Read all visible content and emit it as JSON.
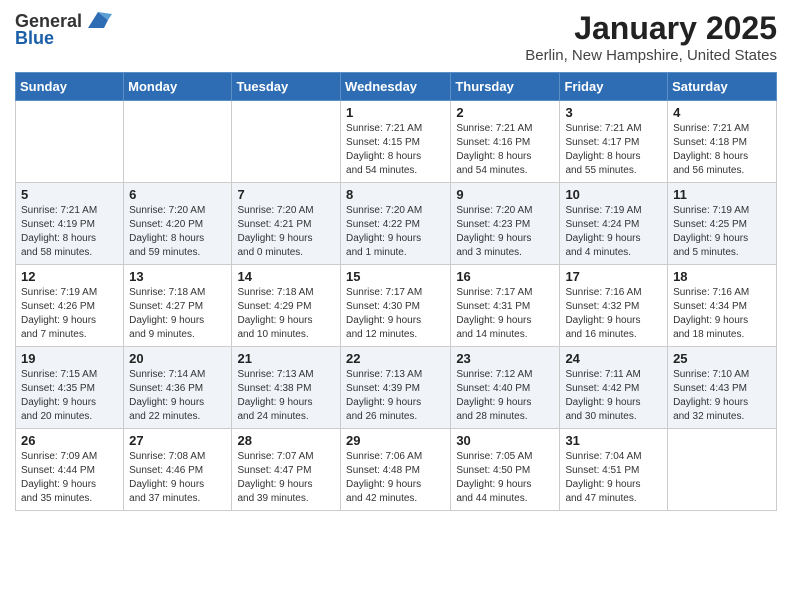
{
  "header": {
    "logo_general": "General",
    "logo_blue": "Blue",
    "month": "January 2025",
    "location": "Berlin, New Hampshire, United States"
  },
  "weekdays": [
    "Sunday",
    "Monday",
    "Tuesday",
    "Wednesday",
    "Thursday",
    "Friday",
    "Saturday"
  ],
  "weeks": [
    [
      {
        "day": "",
        "info": ""
      },
      {
        "day": "",
        "info": ""
      },
      {
        "day": "",
        "info": ""
      },
      {
        "day": "1",
        "info": "Sunrise: 7:21 AM\nSunset: 4:15 PM\nDaylight: 8 hours\nand 54 minutes."
      },
      {
        "day": "2",
        "info": "Sunrise: 7:21 AM\nSunset: 4:16 PM\nDaylight: 8 hours\nand 54 minutes."
      },
      {
        "day": "3",
        "info": "Sunrise: 7:21 AM\nSunset: 4:17 PM\nDaylight: 8 hours\nand 55 minutes."
      },
      {
        "day": "4",
        "info": "Sunrise: 7:21 AM\nSunset: 4:18 PM\nDaylight: 8 hours\nand 56 minutes."
      }
    ],
    [
      {
        "day": "5",
        "info": "Sunrise: 7:21 AM\nSunset: 4:19 PM\nDaylight: 8 hours\nand 58 minutes."
      },
      {
        "day": "6",
        "info": "Sunrise: 7:20 AM\nSunset: 4:20 PM\nDaylight: 8 hours\nand 59 minutes."
      },
      {
        "day": "7",
        "info": "Sunrise: 7:20 AM\nSunset: 4:21 PM\nDaylight: 9 hours\nand 0 minutes."
      },
      {
        "day": "8",
        "info": "Sunrise: 7:20 AM\nSunset: 4:22 PM\nDaylight: 9 hours\nand 1 minute."
      },
      {
        "day": "9",
        "info": "Sunrise: 7:20 AM\nSunset: 4:23 PM\nDaylight: 9 hours\nand 3 minutes."
      },
      {
        "day": "10",
        "info": "Sunrise: 7:19 AM\nSunset: 4:24 PM\nDaylight: 9 hours\nand 4 minutes."
      },
      {
        "day": "11",
        "info": "Sunrise: 7:19 AM\nSunset: 4:25 PM\nDaylight: 9 hours\nand 5 minutes."
      }
    ],
    [
      {
        "day": "12",
        "info": "Sunrise: 7:19 AM\nSunset: 4:26 PM\nDaylight: 9 hours\nand 7 minutes."
      },
      {
        "day": "13",
        "info": "Sunrise: 7:18 AM\nSunset: 4:27 PM\nDaylight: 9 hours\nand 9 minutes."
      },
      {
        "day": "14",
        "info": "Sunrise: 7:18 AM\nSunset: 4:29 PM\nDaylight: 9 hours\nand 10 minutes."
      },
      {
        "day": "15",
        "info": "Sunrise: 7:17 AM\nSunset: 4:30 PM\nDaylight: 9 hours\nand 12 minutes."
      },
      {
        "day": "16",
        "info": "Sunrise: 7:17 AM\nSunset: 4:31 PM\nDaylight: 9 hours\nand 14 minutes."
      },
      {
        "day": "17",
        "info": "Sunrise: 7:16 AM\nSunset: 4:32 PM\nDaylight: 9 hours\nand 16 minutes."
      },
      {
        "day": "18",
        "info": "Sunrise: 7:16 AM\nSunset: 4:34 PM\nDaylight: 9 hours\nand 18 minutes."
      }
    ],
    [
      {
        "day": "19",
        "info": "Sunrise: 7:15 AM\nSunset: 4:35 PM\nDaylight: 9 hours\nand 20 minutes."
      },
      {
        "day": "20",
        "info": "Sunrise: 7:14 AM\nSunset: 4:36 PM\nDaylight: 9 hours\nand 22 minutes."
      },
      {
        "day": "21",
        "info": "Sunrise: 7:13 AM\nSunset: 4:38 PM\nDaylight: 9 hours\nand 24 minutes."
      },
      {
        "day": "22",
        "info": "Sunrise: 7:13 AM\nSunset: 4:39 PM\nDaylight: 9 hours\nand 26 minutes."
      },
      {
        "day": "23",
        "info": "Sunrise: 7:12 AM\nSunset: 4:40 PM\nDaylight: 9 hours\nand 28 minutes."
      },
      {
        "day": "24",
        "info": "Sunrise: 7:11 AM\nSunset: 4:42 PM\nDaylight: 9 hours\nand 30 minutes."
      },
      {
        "day": "25",
        "info": "Sunrise: 7:10 AM\nSunset: 4:43 PM\nDaylight: 9 hours\nand 32 minutes."
      }
    ],
    [
      {
        "day": "26",
        "info": "Sunrise: 7:09 AM\nSunset: 4:44 PM\nDaylight: 9 hours\nand 35 minutes."
      },
      {
        "day": "27",
        "info": "Sunrise: 7:08 AM\nSunset: 4:46 PM\nDaylight: 9 hours\nand 37 minutes."
      },
      {
        "day": "28",
        "info": "Sunrise: 7:07 AM\nSunset: 4:47 PM\nDaylight: 9 hours\nand 39 minutes."
      },
      {
        "day": "29",
        "info": "Sunrise: 7:06 AM\nSunset: 4:48 PM\nDaylight: 9 hours\nand 42 minutes."
      },
      {
        "day": "30",
        "info": "Sunrise: 7:05 AM\nSunset: 4:50 PM\nDaylight: 9 hours\nand 44 minutes."
      },
      {
        "day": "31",
        "info": "Sunrise: 7:04 AM\nSunset: 4:51 PM\nDaylight: 9 hours\nand 47 minutes."
      },
      {
        "day": "",
        "info": ""
      }
    ]
  ]
}
